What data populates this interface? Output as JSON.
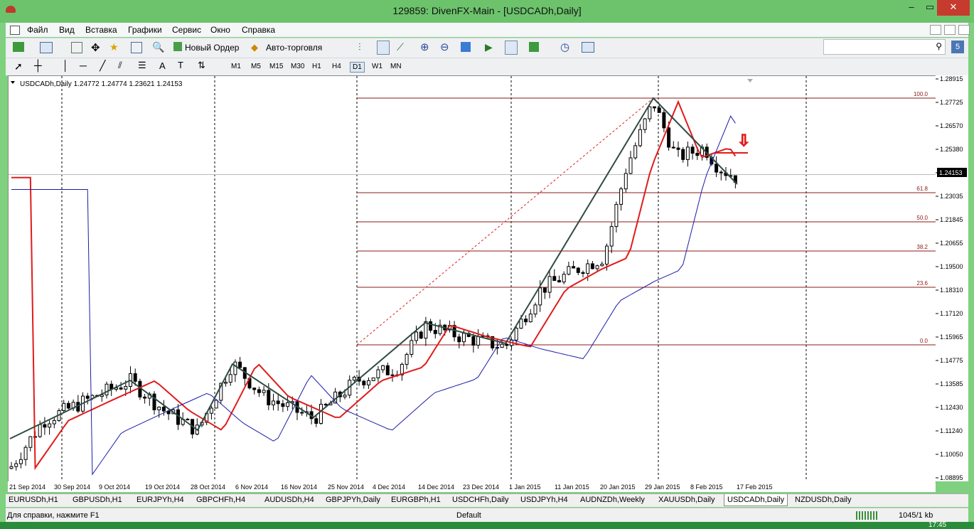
{
  "window": {
    "title": "129859: DivenFX-Main - [USDCADh,Daily]",
    "minimize": "–",
    "maximize": "▭",
    "close": "✕"
  },
  "menu": [
    "Файл",
    "Вид",
    "Вставка",
    "Графики",
    "Сервис",
    "Окно",
    "Справка"
  ],
  "toolbar": {
    "new_order": "Новый Ордер",
    "auto_trading": "Авто-торговля",
    "timeframes": [
      "M1",
      "M5",
      "M15",
      "M30",
      "H1",
      "H4",
      "D1",
      "W1",
      "MN"
    ],
    "active_timeframe": "D1",
    "notification_badge": "5",
    "search_placeholder": ""
  },
  "chart": {
    "header": "USDCADh,Daily  1.24772 1.24774 1.23621 1.24153",
    "current_price": "1.24153",
    "price_axis_labels": [
      "1.28915",
      "1.27725",
      "1.26570",
      "1.25380",
      "1.24190",
      "1.23035",
      "1.21845",
      "1.20655",
      "1.19500",
      "1.18310",
      "1.17120",
      "1.15965",
      "1.14775",
      "1.13585",
      "1.12430",
      "1.11240",
      "1.10050",
      "1.08895"
    ],
    "date_axis_labels": [
      "21 Sep 2014",
      "30 Sep 2014",
      "9 Oct 2014",
      "19 Oct 2014",
      "28 Oct 2014",
      "6 Nov 2014",
      "16 Nov 2014",
      "25 Nov 2014",
      "4 Dec 2014",
      "14 Dec 2014",
      "23 Dec 2014",
      "1 Jan 2015",
      "11 Jan 2015",
      "20 Jan 2015",
      "29 Jan 2015",
      "8 Feb 2015",
      "17 Feb 2015"
    ],
    "fibo_levels": [
      "100.0",
      "61.8",
      "50.0",
      "38.2",
      "23.6",
      "0.0"
    ],
    "colors": {
      "candle": "#000000",
      "ma_fast": "#e11b1b",
      "ma_slow": "#1b1ba8",
      "zigzag": "#2f4a44",
      "fibo": "#8b1a1a",
      "arrow": "#e11b1b"
    }
  },
  "tabs": [
    "EURUSDh,H1",
    "GBPUSDh,H1",
    "EURJPYh,H4",
    "GBPCHFh,H4",
    "AUDUSDh,H4",
    "GBPJPYh,Daily",
    "EURGBPh,H1",
    "USDCHFh,Daily",
    "USDJPYh,H4",
    "AUDNZDh,Weekly",
    "XAUUSDh,Daily",
    "USDCADh,Daily",
    "NZDUSDh,Daily"
  ],
  "active_tab": "USDCADh,Daily",
  "status": {
    "help": "Для справки, нажмите F1",
    "profile": "Default",
    "traffic": "1045/1 kb"
  },
  "taskbar": {
    "clock": "17:45"
  }
}
